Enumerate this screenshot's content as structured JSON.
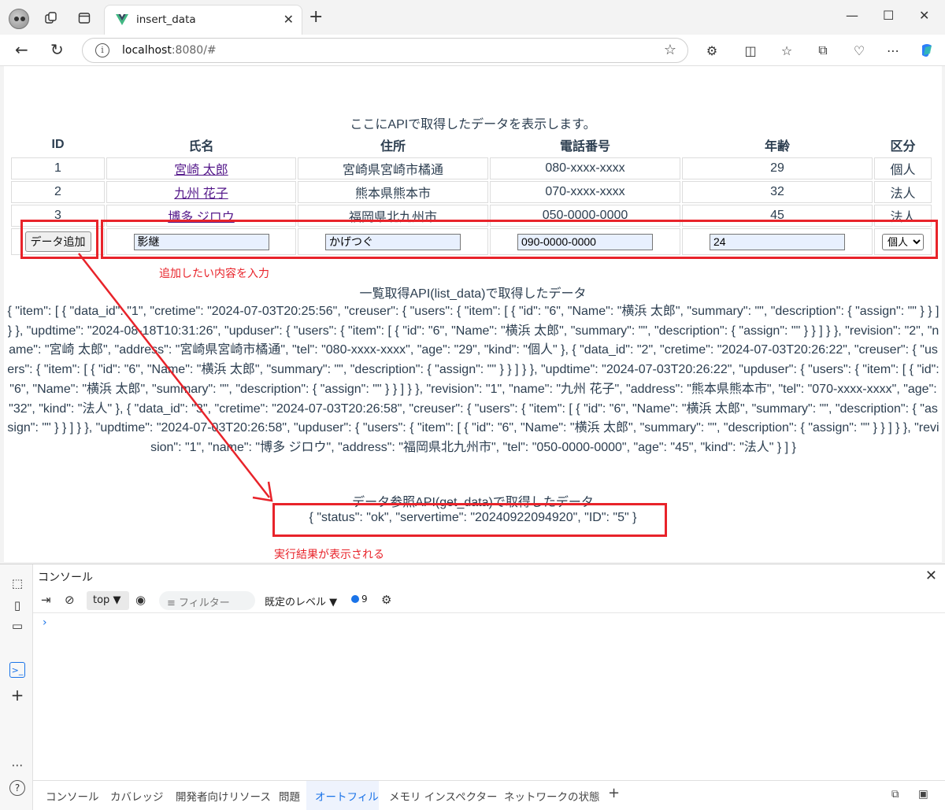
{
  "browser": {
    "tab_title": "insert_data",
    "url_host": "localhost",
    "url_rest": ":8080/#"
  },
  "page": {
    "caption": "ここにAPIで取得したデータを表示します。",
    "columns": [
      "ID",
      "氏名",
      "住所",
      "電話番号",
      "年齢",
      "区分"
    ],
    "rows": [
      {
        "id": "1",
        "name": "宮崎 太郎",
        "address": "宮崎県宮崎市橘通",
        "tel": "080-xxxx-xxxx",
        "age": "29",
        "kind": "個人"
      },
      {
        "id": "2",
        "name": "九州 花子",
        "address": "熊本県熊本市",
        "tel": "070-xxxx-xxxx",
        "age": "32",
        "kind": "法人"
      },
      {
        "id": "3",
        "name": "博多 ジロウ",
        "address": "福岡県北九州市",
        "tel": "050-0000-0000",
        "age": "45",
        "kind": "法人"
      }
    ],
    "form": {
      "add_button": "データ追加",
      "name": "影継",
      "address": "かげつぐ",
      "tel": "090-0000-0000",
      "age": "24",
      "kind": "個人"
    },
    "annotation_input": "追加したい内容を入力",
    "list_title": "一覧取得API(list_data)で取得したデータ",
    "list_json": "{ \"item\": [ { \"data_id\": \"1\", \"cretime\": \"2024-07-03T20:25:56\", \"creuser\": { \"users\": { \"item\": [ { \"id\": \"6\", \"Name\": \"横浜 太郎\", \"summary\": \"\", \"description\": { \"assign\": \"\" } } ] } }, \"updtime\": \"2024-08-18T10:31:26\", \"upduser\": { \"users\": { \"item\": [ { \"id\": \"6\", \"Name\": \"横浜 太郎\", \"summary\": \"\", \"description\": { \"assign\": \"\" } } ] } }, \"revision\": \"2\", \"name\": \"宮崎 太郎\", \"address\": \"宮崎県宮崎市橘通\", \"tel\": \"080-xxxx-xxxx\", \"age\": \"29\", \"kind\": \"個人\" }, { \"data_id\": \"2\", \"cretime\": \"2024-07-03T20:26:22\", \"creuser\": { \"users\": { \"item\": [ { \"id\": \"6\", \"Name\": \"横浜 太郎\", \"summary\": \"\", \"description\": { \"assign\": \"\" } } ] } }, \"updtime\": \"2024-07-03T20:26:22\", \"upduser\": { \"users\": { \"item\": [ { \"id\": \"6\", \"Name\": \"横浜 太郎\", \"summary\": \"\", \"description\": { \"assign\": \"\" } } ] } }, \"revision\": \"1\", \"name\": \"九州 花子\", \"address\": \"熊本県熊本市\", \"tel\": \"070-xxxx-xxxx\", \"age\": \"32\", \"kind\": \"法人\" }, { \"data_id\": \"3\", \"cretime\": \"2024-07-03T20:26:58\", \"creuser\": { \"users\": { \"item\": [ { \"id\": \"6\", \"Name\": \"横浜 太郎\", \"summary\": \"\", \"description\": { \"assign\": \"\" } } ] } }, \"updtime\": \"2024-07-03T20:26:58\", \"upduser\": { \"users\": { \"item\": [ { \"id\": \"6\", \"Name\": \"横浜 太郎\", \"summary\": \"\", \"description\": { \"assign\": \"\" } } ] } }, \"revision\": \"1\", \"name\": \"博多 ジロウ\", \"address\": \"福岡県北九州市\", \"tel\": \"050-0000-0000\", \"age\": \"45\", \"kind\": \"法人\" } ] }",
    "get_title": "データ参照API(get_data)で取得したデータ",
    "get_json": "{ \"status\": \"ok\", \"servertime\": \"20240922094920\", \"ID\": \"5\" }",
    "annotation_result": "実行結果が表示される",
    "annotation_color": "#e8232a"
  },
  "devtools": {
    "title": "コンソール",
    "context": "top",
    "filter_placeholder": "フィルター",
    "level": "既定のレベル",
    "message_count": "9",
    "prompt": "›",
    "tabs": [
      "コンソール",
      "カバレッジ",
      "開発者向けリソース",
      "問題",
      "オートフィル",
      "メモリ インスペクター",
      "ネットワークの状態"
    ],
    "active_tab": "オートフィル"
  }
}
